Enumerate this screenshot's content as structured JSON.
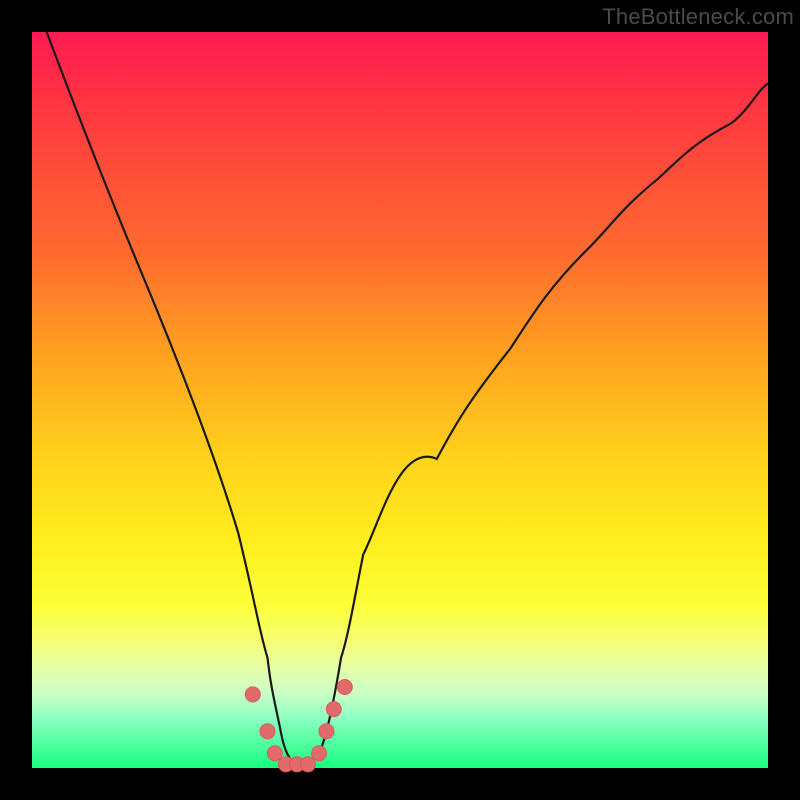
{
  "watermark": "TheBottleneck.com",
  "colors": {
    "frame": "#000000",
    "curve_stroke": "#1a1a1a",
    "marker_fill": "#e16b6b",
    "marker_stroke": "#d85a5a",
    "gradient_top": "#ff1a52",
    "gradient_bottom": "#18ff7f"
  },
  "chart_data": {
    "type": "line",
    "title": "",
    "xlabel": "",
    "ylabel": "",
    "xlim": [
      0,
      100
    ],
    "ylim": [
      0,
      100
    ],
    "grid": false,
    "legend": false,
    "series": [
      {
        "name": "bottleneck-curve",
        "x": [
          2,
          5,
          10,
          15,
          20,
          25,
          28,
          30,
          32,
          33,
          34,
          35,
          36,
          37,
          38,
          40,
          42,
          45,
          50,
          55,
          60,
          65,
          70,
          75,
          80,
          85,
          90,
          95,
          100
        ],
        "y": [
          100,
          92,
          79,
          67,
          55,
          42,
          32,
          24,
          15,
          9,
          4,
          1,
          0,
          0,
          1,
          4,
          9,
          15,
          25,
          34,
          42,
          49,
          55,
          61,
          66,
          70,
          74,
          77,
          80
        ]
      }
    ],
    "markers": [
      {
        "x": 30.0,
        "y": 10
      },
      {
        "x": 32.0,
        "y": 5
      },
      {
        "x": 33.0,
        "y": 2
      },
      {
        "x": 34.5,
        "y": 0.5
      },
      {
        "x": 36.0,
        "y": 0.5
      },
      {
        "x": 37.5,
        "y": 0.5
      },
      {
        "x": 39.0,
        "y": 2
      },
      {
        "x": 40.0,
        "y": 5
      },
      {
        "x": 41.0,
        "y": 8
      },
      {
        "x": 42.5,
        "y": 11
      }
    ]
  }
}
